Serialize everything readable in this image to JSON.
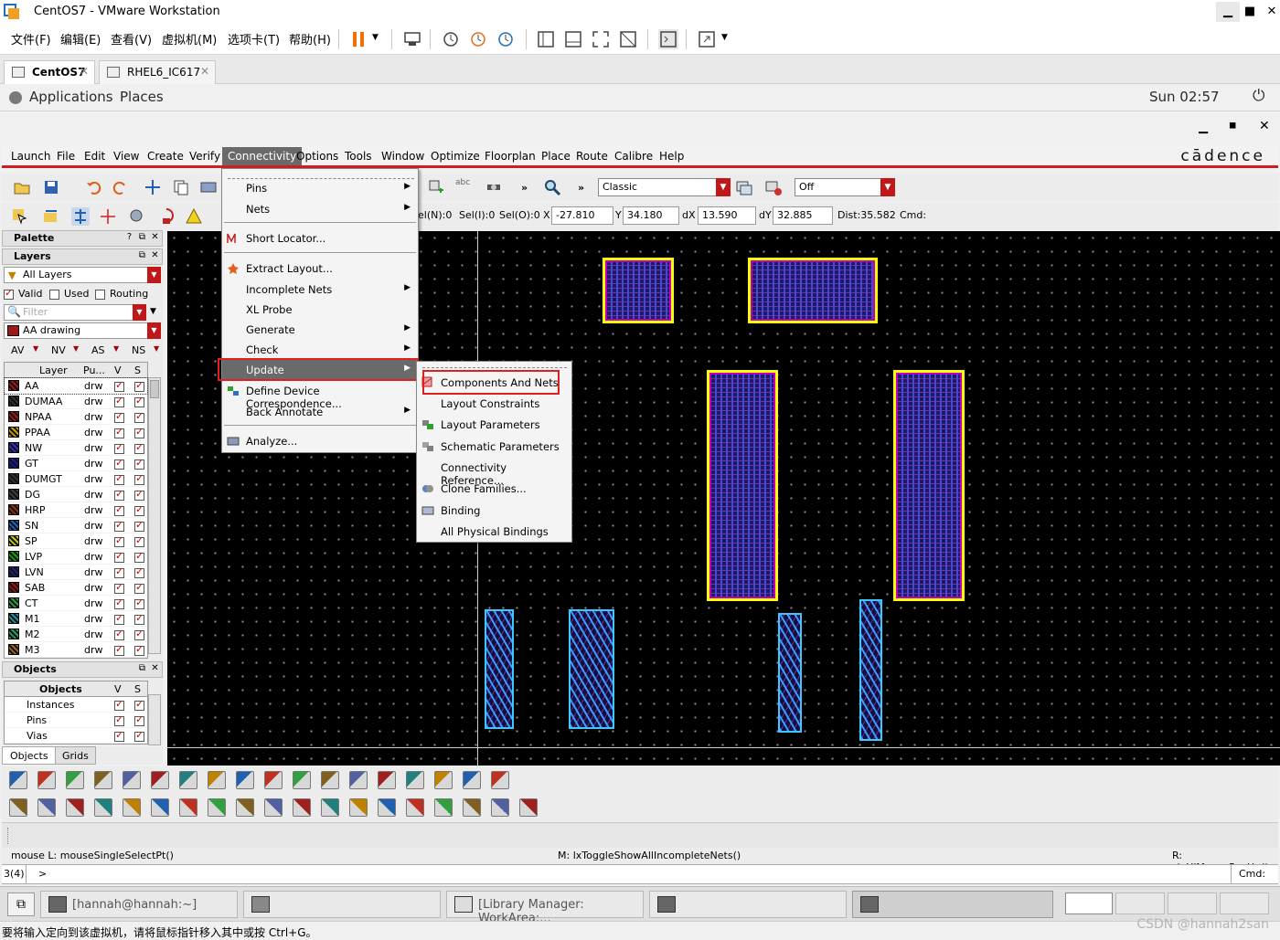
{
  "vmware": {
    "title": "CentOS7 - VMware Workstation",
    "menu": [
      "文件(F)",
      "编辑(E)",
      "查看(V)",
      "虚拟机(M)",
      "选项卡(T)",
      "帮助(H)"
    ],
    "tabs": [
      {
        "label": "CentOS7",
        "active": true
      },
      {
        "label": "RHEL6_IC617",
        "active": false
      }
    ]
  },
  "gnome": {
    "applications": "Applications",
    "places": "Places",
    "clock": "Sun 02:57"
  },
  "virtuoso": {
    "menu": [
      "Launch",
      "File",
      "Edit",
      "View",
      "Create",
      "Verify",
      "Connectivity",
      "Options",
      "Tools",
      "Window",
      "Optimize",
      "Floorplan",
      "Place",
      "Route",
      "Calibre",
      "Help"
    ],
    "active_menu": "Connectivity",
    "brand": "cādence",
    "toolbar": {
      "classic_value": "Classic",
      "off_value": "Off"
    },
    "coords": {
      "seln": "el(N):0",
      "seli": "Sel(I):0",
      "selo": "Sel(O):0",
      "x_label": "X",
      "x": "-27.810",
      "y_label": "Y",
      "y": "34.180",
      "dx_label": "dX",
      "dx": "13.590",
      "dy_label": "dY",
      "dy": "32.885",
      "dist": "Dist:35.582",
      "cmd": "Cmd:"
    }
  },
  "palette": {
    "title": "Palette",
    "layers_title": "Layers",
    "all_layers": "All Layers",
    "valid": "Valid",
    "used": "Used",
    "routing": "Routing",
    "filter_placeholder": "Filter",
    "current_layer": "AA drawing",
    "vis_labels": [
      "AV",
      "NV",
      "AS",
      "NS"
    ],
    "columns": {
      "layer": "Layer",
      "purpose": "Pu...",
      "v": "V",
      "s": "S"
    },
    "layers": [
      {
        "name": "AA",
        "purpose": "drw",
        "color": "#a01818"
      },
      {
        "name": "DUMAA",
        "purpose": "drw",
        "color": "#303030"
      },
      {
        "name": "NPAA",
        "purpose": "drw",
        "color": "#a01818"
      },
      {
        "name": "PPAA",
        "purpose": "drw",
        "color": "#c8a000"
      },
      {
        "name": "NW",
        "purpose": "drw",
        "color": "#3030c0"
      },
      {
        "name": "GT",
        "purpose": "drw",
        "color": "#1818a0"
      },
      {
        "name": "DUMGT",
        "purpose": "drw",
        "color": "#303030"
      },
      {
        "name": "DG",
        "purpose": "drw",
        "color": "#404040"
      },
      {
        "name": "HRP",
        "purpose": "drw",
        "color": "#903010"
      },
      {
        "name": "SN",
        "purpose": "drw",
        "color": "#2060c0"
      },
      {
        "name": "SP",
        "purpose": "drw",
        "color": "#c8c800"
      },
      {
        "name": "LVP",
        "purpose": "drw",
        "color": "#10a010"
      },
      {
        "name": "LVN",
        "purpose": "drw",
        "color": "#202080"
      },
      {
        "name": "SAB",
        "purpose": "drw",
        "color": "#a01010"
      },
      {
        "name": "CT",
        "purpose": "drw",
        "color": "#20a040"
      },
      {
        "name": "M1",
        "purpose": "drw",
        "color": "#2090a0"
      },
      {
        "name": "M2",
        "purpose": "drw",
        "color": "#20a060"
      },
      {
        "name": "M3",
        "purpose": "drw",
        "color": "#a06020"
      }
    ],
    "objects_title": "Objects",
    "objects_columns": {
      "objects": "Objects",
      "v": "V",
      "s": "S"
    },
    "objects": [
      "Instances",
      "Pins",
      "Vias"
    ],
    "bottom_tabs": [
      "Objects",
      "Grids"
    ]
  },
  "connectivity_menu": {
    "items": [
      {
        "label": "Pins",
        "submenu": true
      },
      {
        "label": "Nets",
        "submenu": true
      },
      {
        "label": "Short Locator...",
        "submenu": false
      },
      {
        "label": "Extract Layout...",
        "submenu": false
      },
      {
        "label": "Incomplete Nets",
        "submenu": true
      },
      {
        "label": "XL Probe",
        "submenu": false
      },
      {
        "label": "Generate",
        "submenu": true
      },
      {
        "label": "Check",
        "submenu": true
      },
      {
        "label": "Update",
        "submenu": true
      },
      {
        "label": "Define Device Correspondence...",
        "submenu": false
      },
      {
        "label": "Back Annotate",
        "submenu": true
      },
      {
        "label": "Analyze...",
        "submenu": false
      }
    ],
    "highlighted": "Update"
  },
  "update_menu": {
    "items": [
      "Components And Nets",
      "Layout Constraints",
      "Layout Parameters",
      "Schematic Parameters",
      "Connectivity Reference...",
      "Clone Families...",
      "Binding",
      "All Physical Bindings"
    ],
    "boxed": "Components And Nets"
  },
  "status": {
    "mouse_l": "mouse L: mouseSingleSelectPt()",
    "mouse_m": "M: lxToggleShowAllIncompleteNets()",
    "mouse_r": "R: _lxHiMousePopUp()",
    "prompt_num": "3(4)",
    "prompt": ">",
    "cmd": "Cmd:"
  },
  "taskbar": {
    "items": [
      "[hannah@hannah:~]",
      "",
      "[Library Manager: WorkArea:...",
      "",
      ""
    ],
    "vm_hint": "要将输入定向到该虚拟机，请将鼠标指针移入其中或按 Ctrl+G。",
    "watermark": "CSDN @hannah2san"
  },
  "colors": {
    "accent_red": "#cc2020",
    "highlight": "#6a6a6a",
    "canvas_bg": "#000000"
  }
}
